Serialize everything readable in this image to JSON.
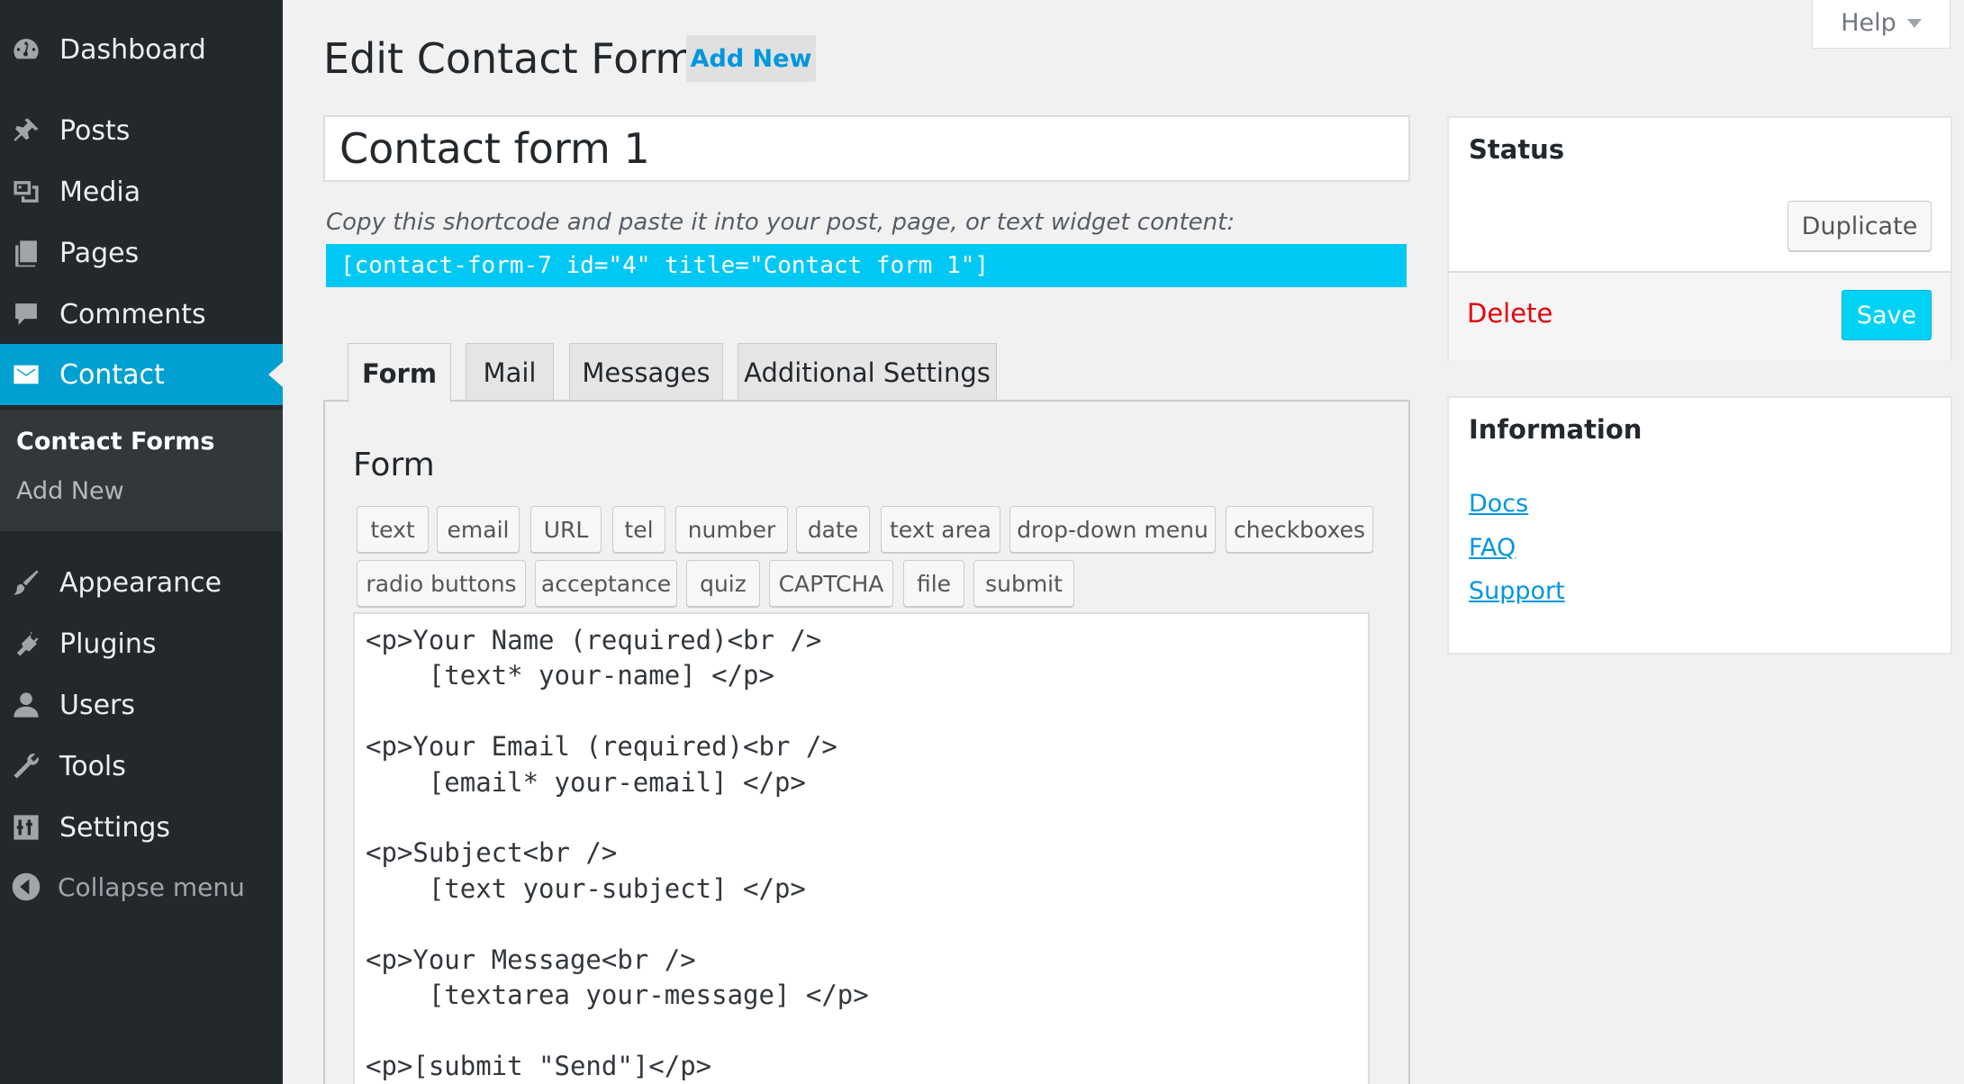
{
  "sidebar": {
    "items": [
      {
        "label": "Dashboard",
        "icon": "dashboard-icon"
      },
      {
        "label": "Posts",
        "icon": "pin-icon"
      },
      {
        "label": "Media",
        "icon": "media-icon"
      },
      {
        "label": "Pages",
        "icon": "pages-icon"
      },
      {
        "label": "Comments",
        "icon": "comment-icon"
      },
      {
        "label": "Contact",
        "icon": "envelope-icon",
        "active": true
      },
      {
        "label": "Appearance",
        "icon": "brush-icon"
      },
      {
        "label": "Plugins",
        "icon": "plug-icon"
      },
      {
        "label": "Users",
        "icon": "user-icon"
      },
      {
        "label": "Tools",
        "icon": "wrench-icon"
      },
      {
        "label": "Settings",
        "icon": "sliders-icon"
      }
    ],
    "submenu": [
      {
        "label": "Contact Forms",
        "current": true
      },
      {
        "label": "Add New"
      }
    ],
    "collapse_label": "Collapse menu"
  },
  "header": {
    "title": "Edit Contact Form",
    "add_new_label": "Add New",
    "help_label": "Help"
  },
  "form": {
    "title_value": "Contact form 1",
    "shortcode_hint": "Copy this shortcode and paste it into your post, page, or text widget content:",
    "shortcode": "[contact-form-7 id=\"4\" title=\"Contact form 1\"]"
  },
  "tabs": [
    {
      "label": "Form",
      "active": true
    },
    {
      "label": "Mail"
    },
    {
      "label": "Messages"
    },
    {
      "label": "Additional Settings"
    }
  ],
  "panel": {
    "title": "Form",
    "tag_buttons_row1": [
      "text",
      "email",
      "URL",
      "tel",
      "number",
      "date",
      "text area",
      "drop-down menu",
      "checkboxes"
    ],
    "tag_buttons_row2": [
      "radio buttons",
      "acceptance",
      "quiz",
      "CAPTCHA",
      "file",
      "submit"
    ],
    "editor_content": "<p>Your Name (required)<br />\n    [text* your-name] </p>\n\n<p>Your Email (required)<br />\n    [email* your-email] </p>\n\n<p>Subject<br />\n    [text your-subject] </p>\n\n<p>Your Message<br />\n    [textarea your-message] </p>\n\n<p>[submit \"Send\"]</p>"
  },
  "status_box": {
    "title": "Status",
    "duplicate_label": "Duplicate",
    "delete_label": "Delete",
    "save_label": "Save"
  },
  "info_box": {
    "title": "Information",
    "links": [
      "Docs",
      "FAQ",
      "Support"
    ]
  },
  "colors": {
    "sidebar_bg": "#23282d",
    "active_menu": "#00a0d2",
    "shortcode_bg": "#00c8f5",
    "save_button": "#00d2f5",
    "delete_text": "#e6000a",
    "link": "#0096dd"
  }
}
